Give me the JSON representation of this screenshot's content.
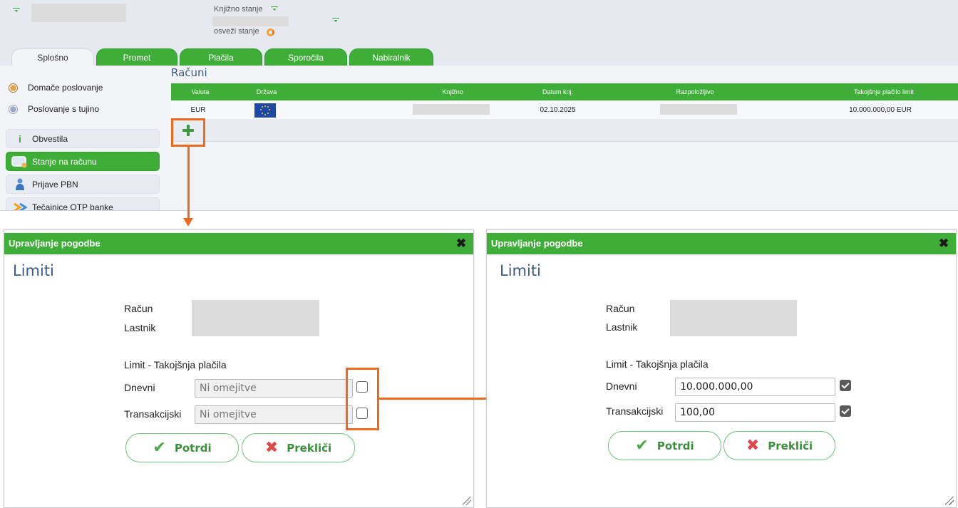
{
  "header": {
    "balance_label": "Knjižno stanje",
    "refresh_label": "osveži stanje"
  },
  "tabs": [
    {
      "label": "Splošno"
    },
    {
      "label": "Promet"
    },
    {
      "label": "Plačila"
    },
    {
      "label": "Sporočila"
    },
    {
      "label": "Nabiralnik"
    }
  ],
  "sidebar": {
    "radios": [
      {
        "label": "Domače poslovanje",
        "selected": true
      },
      {
        "label": "Poslovanje s tujino",
        "selected": false
      }
    ],
    "items": [
      {
        "label": "Obvestila",
        "icon": "info-icon"
      },
      {
        "label": "Stanje na računu",
        "icon": "wallet-icon",
        "active": true
      },
      {
        "label": "Prijave PBN",
        "icon": "user-icon"
      },
      {
        "label": "Tečajnice OTP banke",
        "icon": "exchange-icon"
      }
    ]
  },
  "accounts": {
    "title": "Računi",
    "columns": [
      "Valuta",
      "Država",
      "Knjižno",
      "Datum knj.",
      "Razpoložljivo",
      "Takojšnje plačilo limit"
    ],
    "rows": [
      {
        "currency": "EUR",
        "country_flag": "eu-flag-icon",
        "booked": "",
        "booking_date": "02.10.2025",
        "available": "",
        "instant_limit": "10.000.000,00 EUR"
      }
    ]
  },
  "dialog_before": {
    "title": "Upravljanje pogodbe",
    "heading": "Limiti",
    "account_label": "Račun",
    "owner_label": "Lastnik",
    "section_label": "Limit - Takojšnja plačila",
    "daily_label": "Dnevni",
    "daily_placeholder": "Ni omejitve",
    "daily_checked": false,
    "transaction_label": "Transakcijski",
    "transaction_placeholder": "Ni omejitve",
    "transaction_checked": false,
    "confirm_label": "Potrdi",
    "cancel_label": "Prekliči"
  },
  "dialog_after": {
    "title": "Upravljanje pogodbe",
    "heading": "Limiti",
    "account_label": "Račun",
    "owner_label": "Lastnik",
    "section_label": "Limit - Takojšnja plačila",
    "daily_label": "Dnevni",
    "daily_value": "10.000.000,00",
    "daily_checked": true,
    "transaction_label": "Transakcijski",
    "transaction_value": "100,00",
    "transaction_checked": true,
    "confirm_label": "Potrdi",
    "cancel_label": "Prekliči"
  },
  "colors": {
    "brand_green": "#3fae38",
    "callout_orange": "#ee6b1d",
    "heading_blue": "#3d5a85"
  }
}
